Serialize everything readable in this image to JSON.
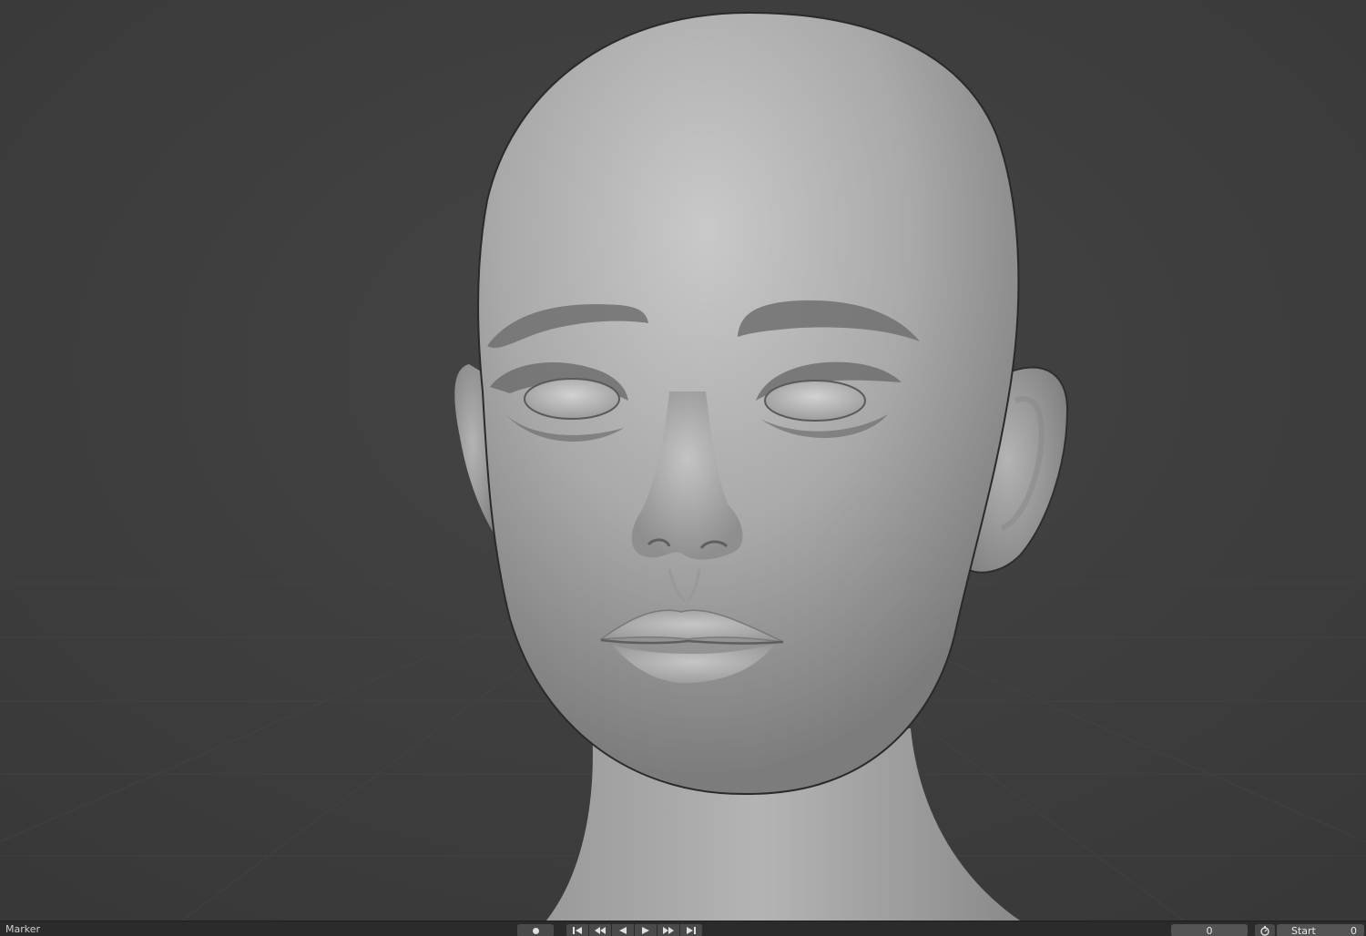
{
  "timeline": {
    "menu_label": "Marker",
    "current_frame": "0",
    "start_label": "Start",
    "start_value": "0"
  },
  "icons": {
    "keyframe": "keyframe-record-icon",
    "jump_start": "jump-to-start-icon",
    "prev_key": "previous-keyframe-icon",
    "play_reverse": "play-reverse-icon",
    "play": "play-icon",
    "next_key": "next-keyframe-icon",
    "jump_end": "jump-to-end-icon",
    "stopwatch": "stopwatch-icon"
  },
  "colors": {
    "viewport_bg": "#3f3f3f",
    "model_surface": "#a9a9a9",
    "timeline_bg": "#2b2b2b"
  }
}
